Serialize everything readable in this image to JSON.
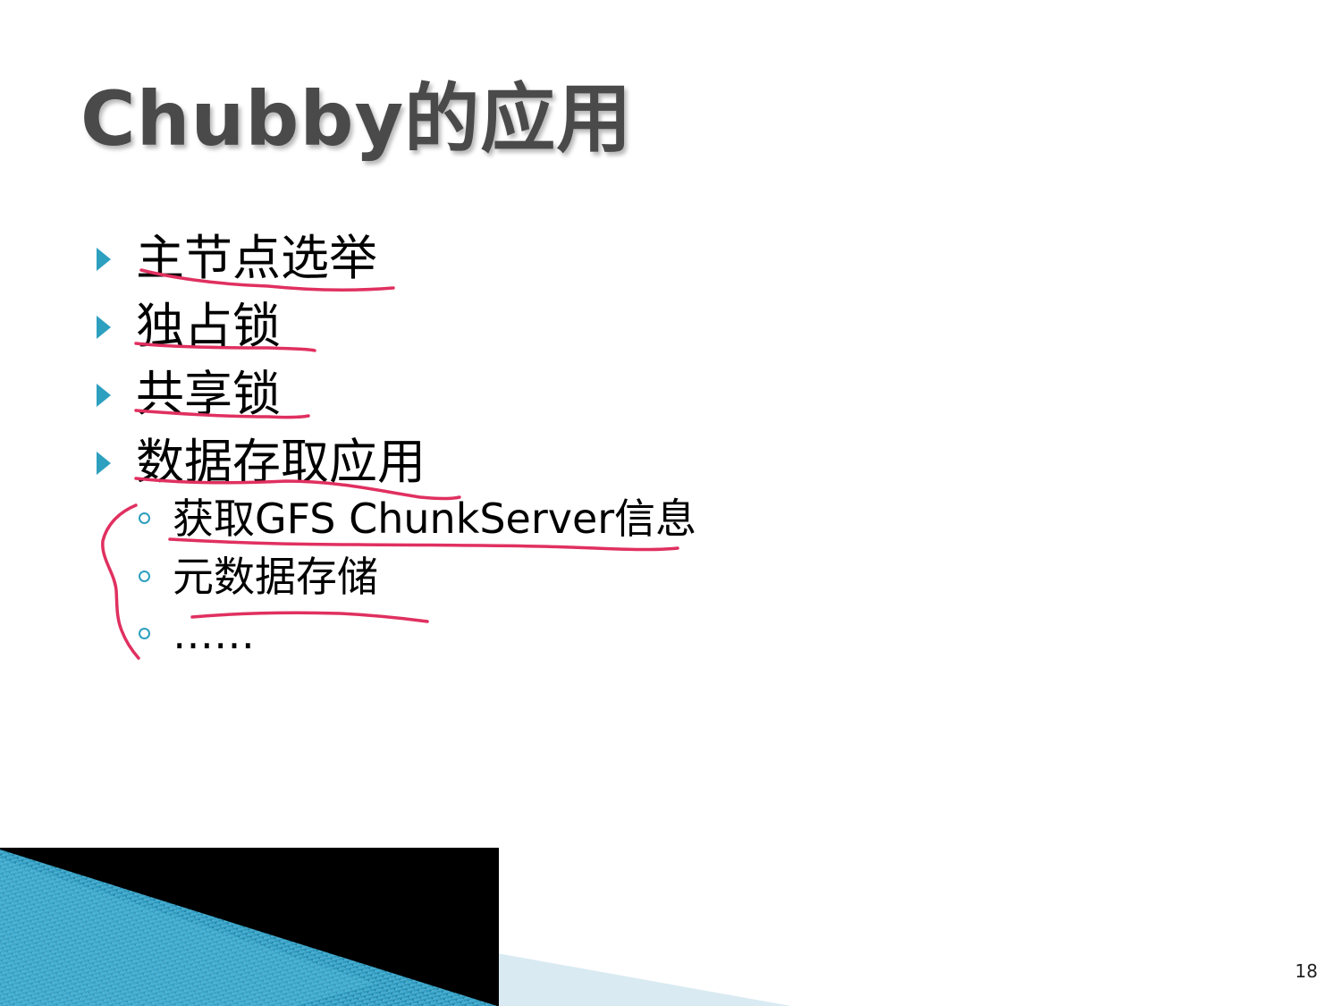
{
  "slide": {
    "title": "Chubby的应用",
    "page_number": "18",
    "bullets": [
      {
        "text": "主节点选举",
        "level": 1
      },
      {
        "text": "独占锁",
        "level": 1
      },
      {
        "text": "共享锁",
        "level": 1
      },
      {
        "text": "数据存取应用",
        "level": 1
      },
      {
        "text": "获取GFS ChunkServer信息",
        "level": 2
      },
      {
        "text": "元数据存储",
        "level": 2
      },
      {
        "text": "……",
        "level": 2
      }
    ]
  },
  "colors": {
    "title": "#4a4a4a",
    "bullet_marker": "#2d9fbf",
    "ink_annotation": "#e03060",
    "footer_dark": "#000000",
    "footer_teal": "#1f8fb5",
    "footer_light": "#d9eaf2"
  },
  "icons": {
    "level1_marker": "triangle-right-icon",
    "level2_marker": "ring-bullet-icon"
  }
}
